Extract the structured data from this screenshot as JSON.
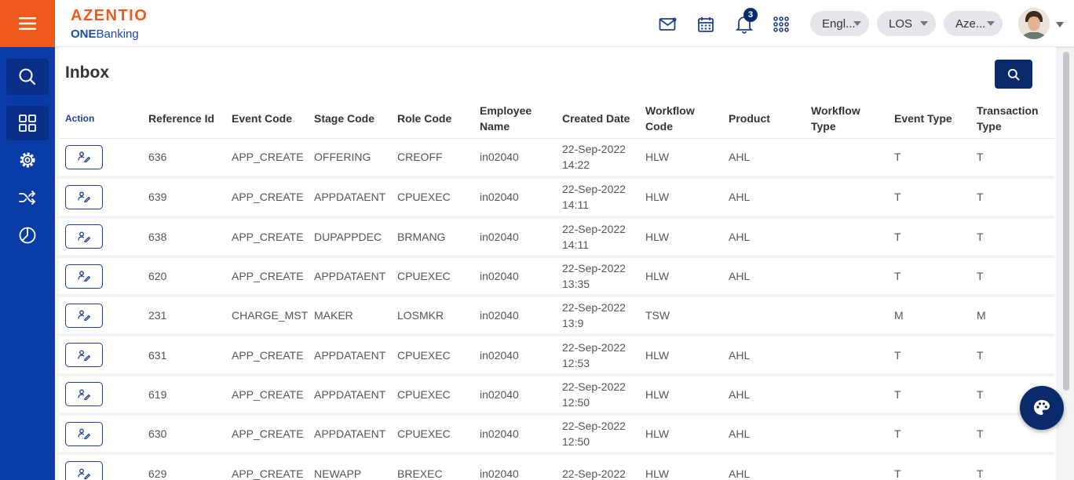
{
  "brand": {
    "name": "AZENTIO",
    "sub_bold": "ONE",
    "sub_regular": "Banking"
  },
  "header": {
    "notification_count": "3",
    "language": "Engl...",
    "module": "LOS",
    "entity": "Aze..."
  },
  "page": {
    "title": "Inbox"
  },
  "table": {
    "headers": {
      "action": "Action",
      "reference_id": "Reference Id",
      "event_code": "Event Code",
      "stage_code": "Stage Code",
      "role_code": "Role Code",
      "employee_name": "Employee Name",
      "created_date": "Created Date",
      "workflow_code": "Workflow Code",
      "product": "Product",
      "workflow_type": "Workflow Type",
      "event_type": "Event Type",
      "transaction_type": "Transaction Type"
    },
    "rows": [
      {
        "ref": "636",
        "event": "APP_CREATE",
        "stage": "OFFERING",
        "role": "CREOFF",
        "emp": "in02040",
        "date": "22-Sep-2022",
        "time": "14:22",
        "wf": "HLW",
        "product": "AHL",
        "wftype": "",
        "evtype": "T",
        "txtype": "T"
      },
      {
        "ref": "639",
        "event": "APP_CREATE",
        "stage": "APPDATAENT",
        "role": "CPUEXEC",
        "emp": "in02040",
        "date": "22-Sep-2022",
        "time": "14:11",
        "wf": "HLW",
        "product": "AHL",
        "wftype": "",
        "evtype": "T",
        "txtype": "T"
      },
      {
        "ref": "638",
        "event": "APP_CREATE",
        "stage": "DUPAPPDEC",
        "role": "BRMANG",
        "emp": "in02040",
        "date": "22-Sep-2022",
        "time": "14:11",
        "wf": "HLW",
        "product": "AHL",
        "wftype": "",
        "evtype": "T",
        "txtype": "T"
      },
      {
        "ref": "620",
        "event": "APP_CREATE",
        "stage": "APPDATAENT",
        "role": "CPUEXEC",
        "emp": "in02040",
        "date": "22-Sep-2022",
        "time": "13:35",
        "wf": "HLW",
        "product": "AHL",
        "wftype": "",
        "evtype": "T",
        "txtype": "T"
      },
      {
        "ref": "231",
        "event": "CHARGE_MST",
        "stage": "MAKER",
        "role": "LOSMKR",
        "emp": "in02040",
        "date": "22-Sep-2022",
        "time": "13:9",
        "wf": "TSW",
        "product": "",
        "wftype": "",
        "evtype": "M",
        "txtype": "M"
      },
      {
        "ref": "631",
        "event": "APP_CREATE",
        "stage": "APPDATAENT",
        "role": "CPUEXEC",
        "emp": "in02040",
        "date": "22-Sep-2022",
        "time": "12:53",
        "wf": "HLW",
        "product": "AHL",
        "wftype": "",
        "evtype": "T",
        "txtype": "T"
      },
      {
        "ref": "619",
        "event": "APP_CREATE",
        "stage": "APPDATAENT",
        "role": "CPUEXEC",
        "emp": "in02040",
        "date": "22-Sep-2022",
        "time": "12:50",
        "wf": "HLW",
        "product": "AHL",
        "wftype": "",
        "evtype": "T",
        "txtype": "T"
      },
      {
        "ref": "630",
        "event": "APP_CREATE",
        "stage": "APPDATAENT",
        "role": "CPUEXEC",
        "emp": "in02040",
        "date": "22-Sep-2022",
        "time": "12:50",
        "wf": "HLW",
        "product": "AHL",
        "wftype": "",
        "evtype": "T",
        "txtype": "T"
      },
      {
        "ref": "629",
        "event": "APP_CREATE",
        "stage": "NEWAPP",
        "role": "BREXEC",
        "emp": "in02040",
        "date": "22-Sep-2022",
        "time": "",
        "wf": "HLW",
        "product": "AHL",
        "wftype": "",
        "evtype": "T",
        "txtype": "T"
      }
    ]
  },
  "icons": {
    "menu": "hamburger-menu-icon",
    "sidebar": [
      "search-icon",
      "dashboard-grid-icon",
      "settings-gear-icon",
      "shuffle-icon",
      "pie-chart-icon"
    ],
    "top": [
      "mail-icon",
      "calendar-icon",
      "bell-icon",
      "apps-grid-icon"
    ],
    "row_action": "edit-user-icon",
    "fab": "palette-icon"
  },
  "colors": {
    "primary": "#0a3ca8",
    "accent": "#ee5a1b",
    "dark_button": "#0b2a6b"
  }
}
